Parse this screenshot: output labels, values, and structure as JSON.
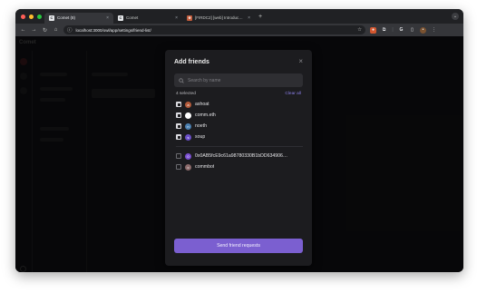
{
  "browser": {
    "tabs": [
      {
        "favicon": "C",
        "label": "Comet (8)",
        "close": "×",
        "active": true
      },
      {
        "favicon": "C",
        "label": "Comet",
        "close": "×",
        "active": false
      },
      {
        "favicon": "✳",
        "label": "[FIRDC2] [web] Introduce c…",
        "close": "×",
        "active": false
      }
    ],
    "newtab": "+",
    "url": "localhost:3000/owl/app/settings/friend-list/"
  },
  "app": {
    "title": "Comet"
  },
  "modal": {
    "title": "Add friends",
    "close": "×",
    "search_placeholder": "Search by name",
    "selected_count": "4 selected",
    "clear_all": "Clear all",
    "selected_items": [
      {
        "name": "ashoat",
        "avatar_color": "#b35a3a",
        "avatar_glyph": "a"
      },
      {
        "name": "comm.eth",
        "avatar_color": "#ffffff",
        "avatar_glyph": ""
      },
      {
        "name": "noeth",
        "avatar_color": "#4a7fb0",
        "avatar_glyph": "n"
      },
      {
        "name": "soup",
        "avatar_color": "#6b4fc8",
        "avatar_glyph": "s"
      }
    ],
    "unselected_items": [
      {
        "name": "0x0AB5fcE9c61a98780330B1bDD634906…",
        "avatar_color": "#7a4fd0",
        "avatar_glyph": "0"
      },
      {
        "name": "commbot",
        "avatar_color": "#8c6b6b",
        "avatar_glyph": "c"
      }
    ],
    "send_button": "Send friend requests"
  },
  "colors": {
    "accent": "#7b5fd0",
    "link": "#8b7fe8",
    "background": "#0c0c0e"
  }
}
